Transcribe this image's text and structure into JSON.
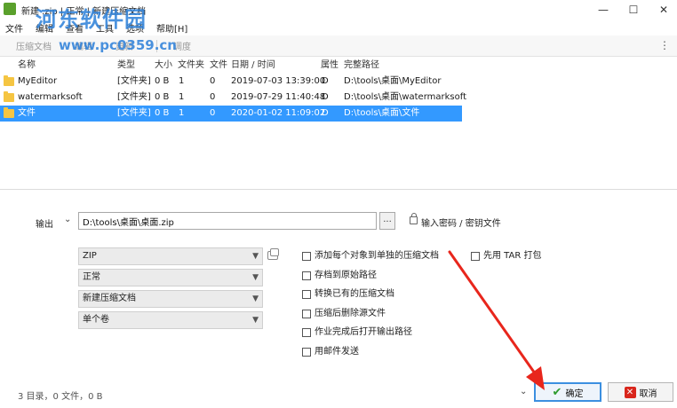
{
  "window": {
    "title": "新建 .zip | 正常 | 新建压缩文档",
    "minimize": "—",
    "maximize": "☐",
    "close": "✕"
  },
  "watermark": {
    "logo": "河东软件园",
    "url": "www.pc0359.cn"
  },
  "menu": [
    "文件",
    "编辑",
    "查看",
    "工具",
    "选项",
    "帮助[H]"
  ],
  "toolbar": {
    "buttons": [
      "压缩文档",
      "编辑",
      "更新",
      "调度"
    ],
    "more": "⋮"
  },
  "filelist": {
    "columns": [
      "名称",
      "类型",
      "大小",
      "文件夹",
      "文件",
      "日期 / 时间",
      "属性",
      "完整路径"
    ],
    "rows": [
      {
        "name": "MyEditor",
        "type": "[文件夹]",
        "size": "0 B",
        "folders": "1",
        "files": "0",
        "date": "2019-07-03 13:39:00",
        "attr": "D",
        "path": "D:\\tools\\桌面\\MyEditor"
      },
      {
        "name": "watermarksoft",
        "type": "[文件夹]",
        "size": "0 B",
        "folders": "1",
        "files": "0",
        "date": "2019-07-29 11:40:48",
        "attr": "D",
        "path": "D:\\tools\\桌面\\watermarksoft"
      },
      {
        "name": "文件",
        "type": "[文件夹]",
        "size": "0 B",
        "folders": "1",
        "files": "0",
        "date": "2020-01-02 11:09:02",
        "attr": "D",
        "path": "D:\\tools\\桌面\\文件"
      }
    ]
  },
  "output": {
    "label": "输出",
    "path": "D:\\tools\\桌面\\桌面.zip",
    "browse": "...",
    "password_link": "输入密码 / 密钥文件"
  },
  "selects": {
    "format": "ZIP",
    "level": "正常",
    "mode": "新建压缩文档",
    "volume": "单个卷"
  },
  "options": {
    "separate": "添加每个对象到单独的压缩文档",
    "tar_first": "先用 TAR 打包",
    "store_path": "存档到原始路径",
    "convert": "转换已有的压缩文档",
    "delete_source": "压缩后删除源文件",
    "open_output": "作业完成后打开输出路径",
    "send_mail": "用邮件发送"
  },
  "status": "3 目录，0 文件，0 B",
  "buttons": {
    "ok": "确定",
    "cancel": "取消"
  },
  "colors": {
    "selection": "#3399ff",
    "annotation_arrow": "#e8261c",
    "ok_border": "#3b8fe0"
  }
}
